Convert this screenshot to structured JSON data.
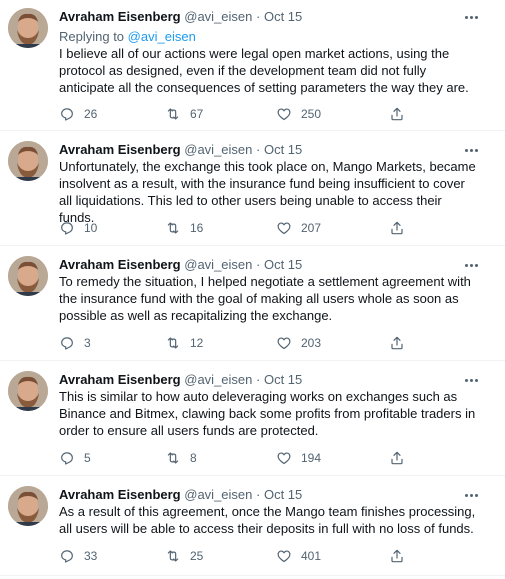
{
  "tweets": [
    {
      "author": "Avraham Eisenberg",
      "handle": "@avi_eisen",
      "separator": "·",
      "date": "Oct 15",
      "replying_prefix": "Replying to",
      "replying_to": "@avi_eisen",
      "text": "I believe all of our actions were legal open market actions, using the protocol as designed, even if the development team did not fully anticipate all the consequences of setting parameters the way they are.",
      "replies": "26",
      "retweets": "67",
      "likes": "250"
    },
    {
      "author": "Avraham Eisenberg",
      "handle": "@avi_eisen",
      "separator": "·",
      "date": "Oct 15",
      "text": "Unfortunately, the exchange this took place on, Mango Markets, became insolvent as a result, with the insurance fund being insufficient to cover all liquidations. This led to other users being unable to access their funds.",
      "replies": "10",
      "retweets": "16",
      "likes": "207"
    },
    {
      "author": "Avraham Eisenberg",
      "handle": "@avi_eisen",
      "separator": "·",
      "date": "Oct 15",
      "text": "To remedy the situation, I helped negotiate a settlement agreement with the insurance fund with the goal of making all users whole as soon as possible as well as recapitalizing the exchange.",
      "replies": "3",
      "retweets": "12",
      "likes": "203"
    },
    {
      "author": "Avraham Eisenberg",
      "handle": "@avi_eisen",
      "separator": "·",
      "date": "Oct 15",
      "text": "This is similar to how auto deleveraging works on exchanges such as Binance and Bitmex, clawing back some profits from profitable traders in order to ensure all users funds are protected.",
      "replies": "5",
      "retweets": "8",
      "likes": "194"
    },
    {
      "author": "Avraham Eisenberg",
      "handle": "@avi_eisen",
      "separator": "·",
      "date": "Oct 15",
      "text": "As a result of this agreement, once the Mango team finishes processing, all users will be able to access their deposits in full with no loss of funds.",
      "replies": "33",
      "retweets": "25",
      "likes": "401"
    }
  ],
  "icons": {
    "more": "more-icon",
    "reply": "reply-icon",
    "retweet": "retweet-icon",
    "like": "heart-icon",
    "share": "share-icon"
  },
  "colors": {
    "text": "#0f1419",
    "secondary": "#536471",
    "link": "#1d9bf0",
    "divider": "#eff3f4"
  }
}
